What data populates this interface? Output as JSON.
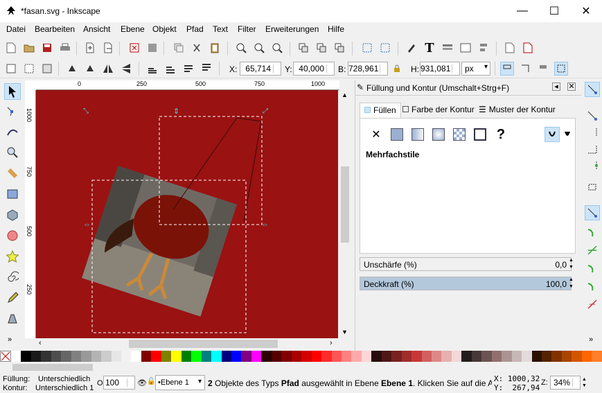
{
  "window": {
    "title": "*fasan.svg - Inkscape",
    "minimize": "—",
    "maximize": "☐",
    "close": "✕"
  },
  "menu": [
    {
      "label": "Datei"
    },
    {
      "label": "Bearbeiten"
    },
    {
      "label": "Ansicht"
    },
    {
      "label": "Ebene"
    },
    {
      "label": "Objekt"
    },
    {
      "label": "Pfad"
    },
    {
      "label": "Text"
    },
    {
      "label": "Filter"
    },
    {
      "label": "Erweiterungen"
    },
    {
      "label": "Hilfe"
    }
  ],
  "controls": {
    "x_label": "X:",
    "x_value": "65,714",
    "y_label": "Y:",
    "y_value": "40,000",
    "w_label": "B:",
    "w_value": "728,961",
    "h_label": "H:",
    "h_value": "931,081",
    "unit": "px"
  },
  "ruler": {
    "h_ticks": [
      "0",
      "250",
      "500",
      "750",
      "1000"
    ],
    "v_ticks": [
      "1000",
      "750",
      "500",
      "250"
    ]
  },
  "panel": {
    "title": "Füllung und Kontur (Umschalt+Strg+F)",
    "tabs": [
      "Füllen",
      "Farbe der Kontur",
      "Muster der Kontur"
    ],
    "fill_mode_title": "Mehrfachstile",
    "blur_label": "Unschärfe (%)",
    "blur_value": "0,0",
    "opacity_label": "Deckkraft (%)",
    "opacity_value": "100,0"
  },
  "status": {
    "fill_label": "Füllung:",
    "fill_value": "Unterschiedlich",
    "stroke_label": "Kontur:",
    "stroke_value": "Unterschiedlich 1",
    "opacity_label": "O:",
    "opacity_value": "100",
    "layer": "•Ebene 1",
    "message_count": "2",
    "message_a": " Objekte des Typs ",
    "message_type": "Pfad",
    "message_b": " ausgewählt in Ebene ",
    "message_layer": "Ebene 1",
    "message_c": ". Klicken Sie auf die Aus",
    "cursor_x": "X: 1000,32",
    "cursor_y": "Y:  267,94",
    "zoom_label": "Z:",
    "zoom_value": "34%"
  },
  "colors": {
    "canvas": "#9a1212",
    "accent": "#00a8d8",
    "handle": "#44d6e8"
  },
  "palette": [
    "#ffffff",
    "#000000",
    "#1a1a1a",
    "#333333",
    "#4d4d4d",
    "#666666",
    "#808080",
    "#999999",
    "#b3b3b3",
    "#cccccc",
    "#e6e6e6",
    "#f2f2f2",
    "#ffffff",
    "#800000",
    "#ff0000",
    "#808000",
    "#ffff00",
    "#008000",
    "#00ff00",
    "#008080",
    "#00ffff",
    "#000080",
    "#0000ff",
    "#800080",
    "#ff00ff",
    "#2b0000",
    "#550000",
    "#800000",
    "#aa0000",
    "#d40000",
    "#ff0000",
    "#ff2a2a",
    "#ff5555",
    "#ff8080",
    "#ffaaaa",
    "#ffd5d5",
    "#280b0b",
    "#501616",
    "#782121",
    "#a02c2c",
    "#c83737",
    "#d35f5f",
    "#de8787",
    "#e9afaf",
    "#f4d7d7",
    "#241c1c",
    "#483737",
    "#6c5353",
    "#916f6f",
    "#ac9393",
    "#c8b7b7",
    "#e3dbdb",
    "#2b1100",
    "#552200",
    "#803300",
    "#aa4400",
    "#d45500",
    "#ff6600",
    "#ff7f2a"
  ]
}
